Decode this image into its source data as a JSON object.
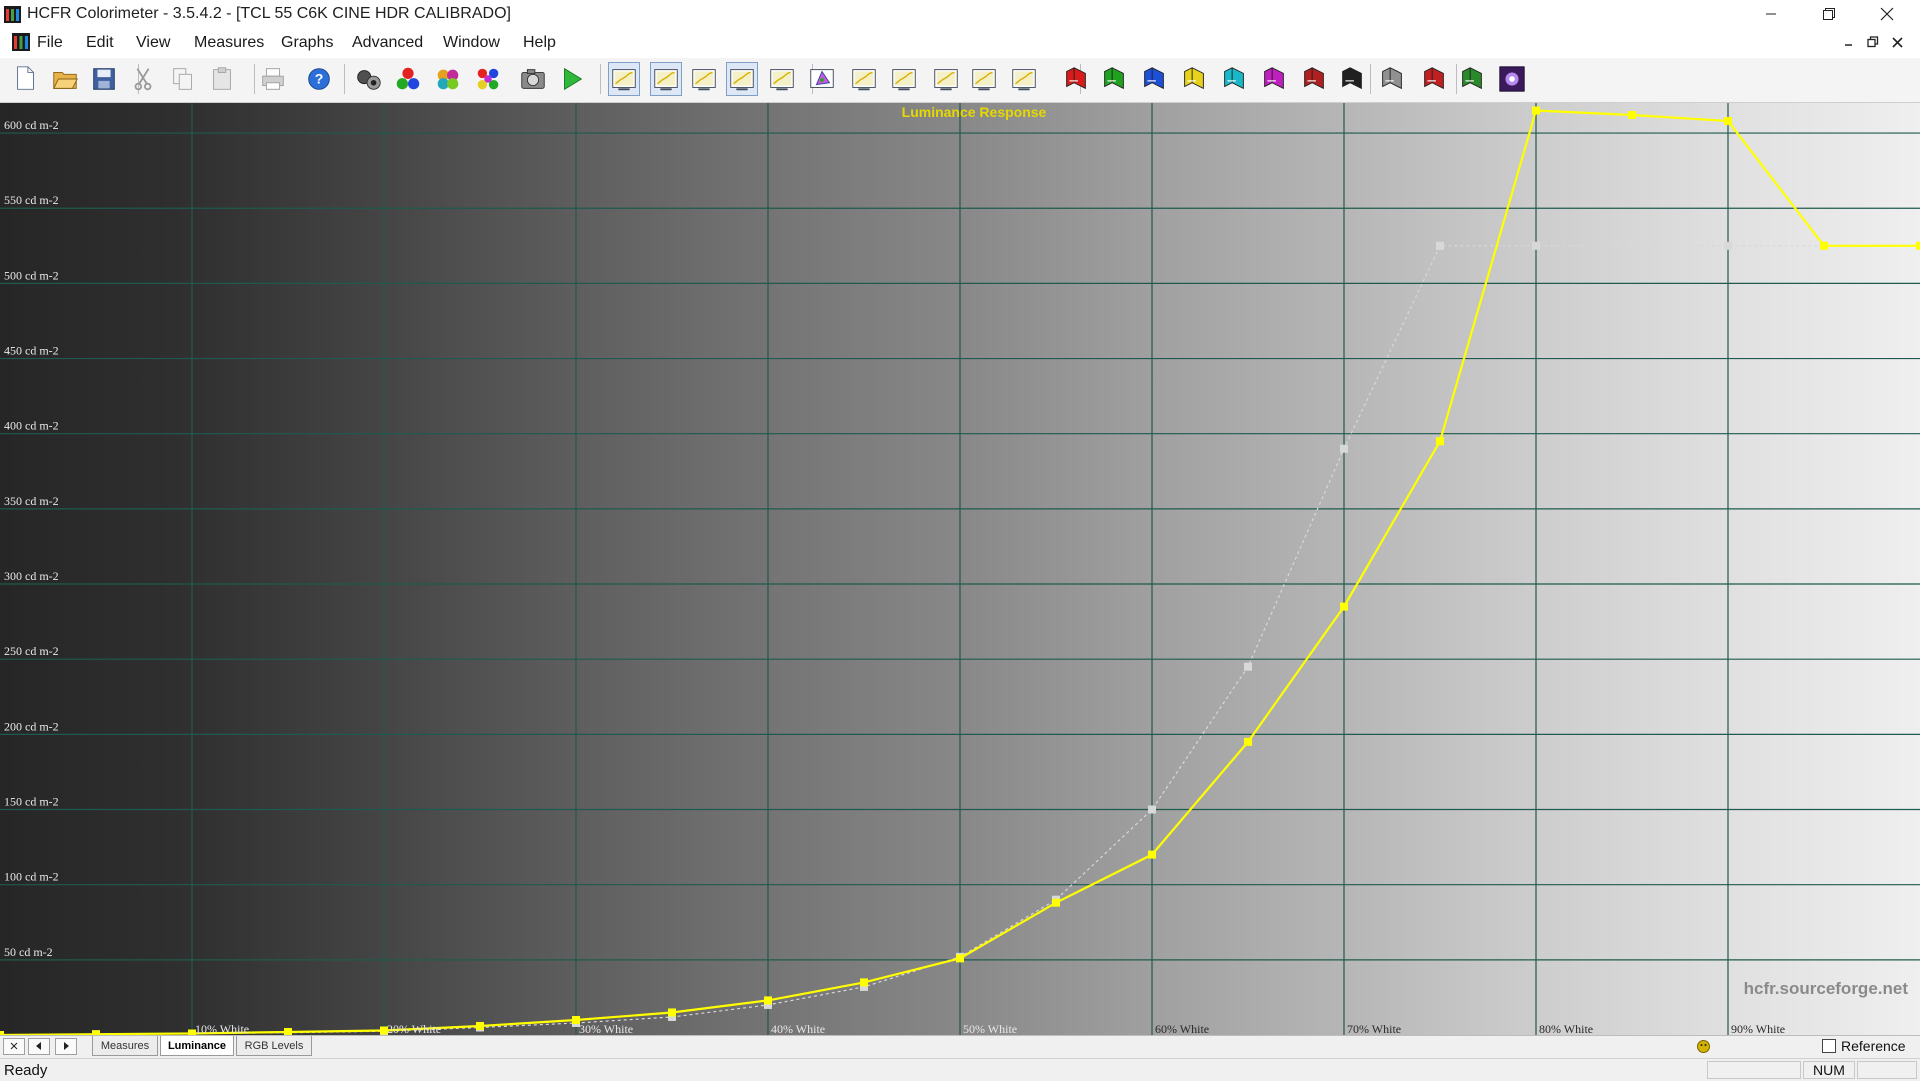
{
  "window": {
    "title": "HCFR Colorimeter - 3.5.4.2 - [TCL 55 C6K CINE HDR CALIBRADO]"
  },
  "menu": {
    "items": [
      "File",
      "Edit",
      "View",
      "Measures",
      "Graphs",
      "Advanced",
      "Window",
      "Help"
    ]
  },
  "toolbar": {
    "buttons": [
      "new-document-icon",
      "open-folder-icon",
      "save-disk-icon",
      "cut-icon",
      "copy-icon",
      "paste-icon",
      "print-icon",
      "help-icon",
      "sensor-probe-icon",
      "rgb-circles-icon",
      "color-wheel-icon",
      "color-palette-icon",
      "camera-icon",
      "play-icon",
      "graph-view-1-icon",
      "graph-view-2-icon",
      "graph-view-3-icon",
      "graph-view-4-icon",
      "graph-view-5-icon",
      "cie-diagram-icon",
      "graph-view-7-icon",
      "graph-view-8-icon",
      "graph-view-9-icon",
      "graph-view-10-icon",
      "graph-view-11-icon",
      "red-measure-icon",
      "green-measure-icon",
      "blue-measure-icon",
      "yellow-measure-icon",
      "cyan-measure-icon",
      "magenta-measure-icon",
      "red-grey-measure-icon",
      "black-measure-icon",
      "grey-measure-icon",
      "rgb-measure-1-icon",
      "rgb-measure-2-icon",
      "purple-sparkle-icon"
    ]
  },
  "chart_data": {
    "type": "line",
    "title": "Luminance Response",
    "ylabel_unit": "cd m-2",
    "ylim": [
      0,
      620
    ],
    "y_ticks": [
      "50 cd m-2",
      "100 cd m-2",
      "150 cd m-2",
      "200 cd m-2",
      "250 cd m-2",
      "300 cd m-2",
      "350 cd m-2",
      "400 cd m-2",
      "450 cd m-2",
      "500 cd m-2",
      "550 cd m-2",
      "600 cd m-2"
    ],
    "x_ticks": [
      "10% White",
      "20% White",
      "30% White",
      "40% White",
      "50% White",
      "60% White",
      "70% White",
      "80% White",
      "90% White"
    ],
    "x": [
      0,
      5,
      10,
      15,
      20,
      25,
      30,
      35,
      40,
      45,
      50,
      55,
      60,
      65,
      70,
      75,
      80,
      85,
      90,
      95,
      100
    ],
    "series": [
      {
        "color": "#ffff00",
        "values": [
          0,
          0.5,
          1,
          2,
          3,
          6,
          10,
          15,
          23,
          35,
          51,
          88,
          120,
          195,
          285,
          395,
          615,
          612,
          608,
          525,
          525
        ]
      },
      {
        "color": "#d8d8d8",
        "values": [
          0,
          0.5,
          1,
          1.5,
          2.5,
          5,
          8,
          12,
          20,
          32,
          52,
          90,
          150,
          245,
          390,
          525,
          525,
          525,
          525,
          525,
          525
        ]
      }
    ],
    "watermark": "hcfr.sourceforge.net",
    "reference_label": "Reference",
    "grid": true
  },
  "tabs": {
    "items": [
      "Measures",
      "Luminance",
      "RGB Levels"
    ],
    "active": 1
  },
  "status": {
    "text": "Ready",
    "num": "NUM"
  }
}
